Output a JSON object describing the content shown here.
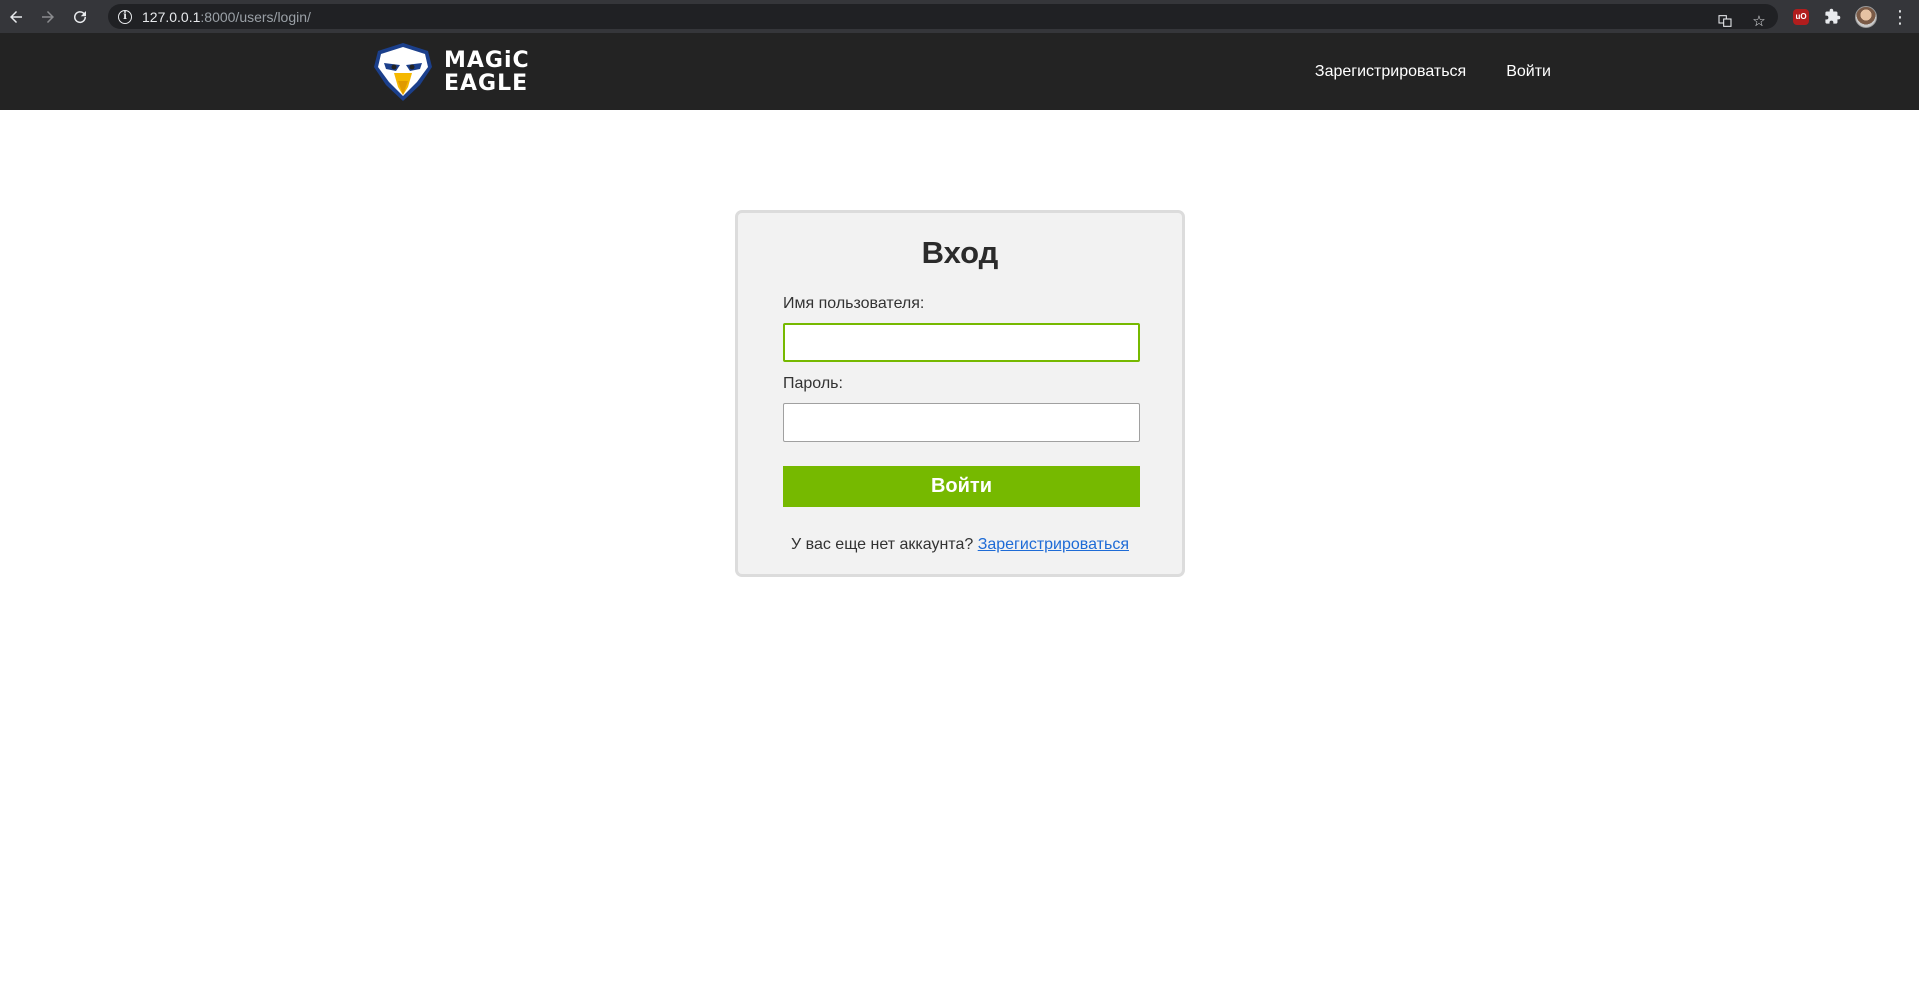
{
  "browser": {
    "url_host": "127.0.0.1",
    "url_rest": ":8000/users/login/",
    "ext_badge": "uO"
  },
  "header": {
    "logo_line1": "MAGiC",
    "logo_line2": "EAGLE",
    "nav": {
      "register": "Зарегистрироваться",
      "login": "Войти"
    }
  },
  "login": {
    "title": "Вход",
    "username_label": "Имя пользователя:",
    "username_value": "",
    "password_label": "Пароль:",
    "password_value": "",
    "submit_label": "Войти",
    "no_account_text": "У вас еще нет аккаунта? ",
    "register_link": "Зарегистрироваться"
  },
  "colors": {
    "accent": "#76b900",
    "header_bg": "#232323",
    "link": "#1e6bd6"
  }
}
